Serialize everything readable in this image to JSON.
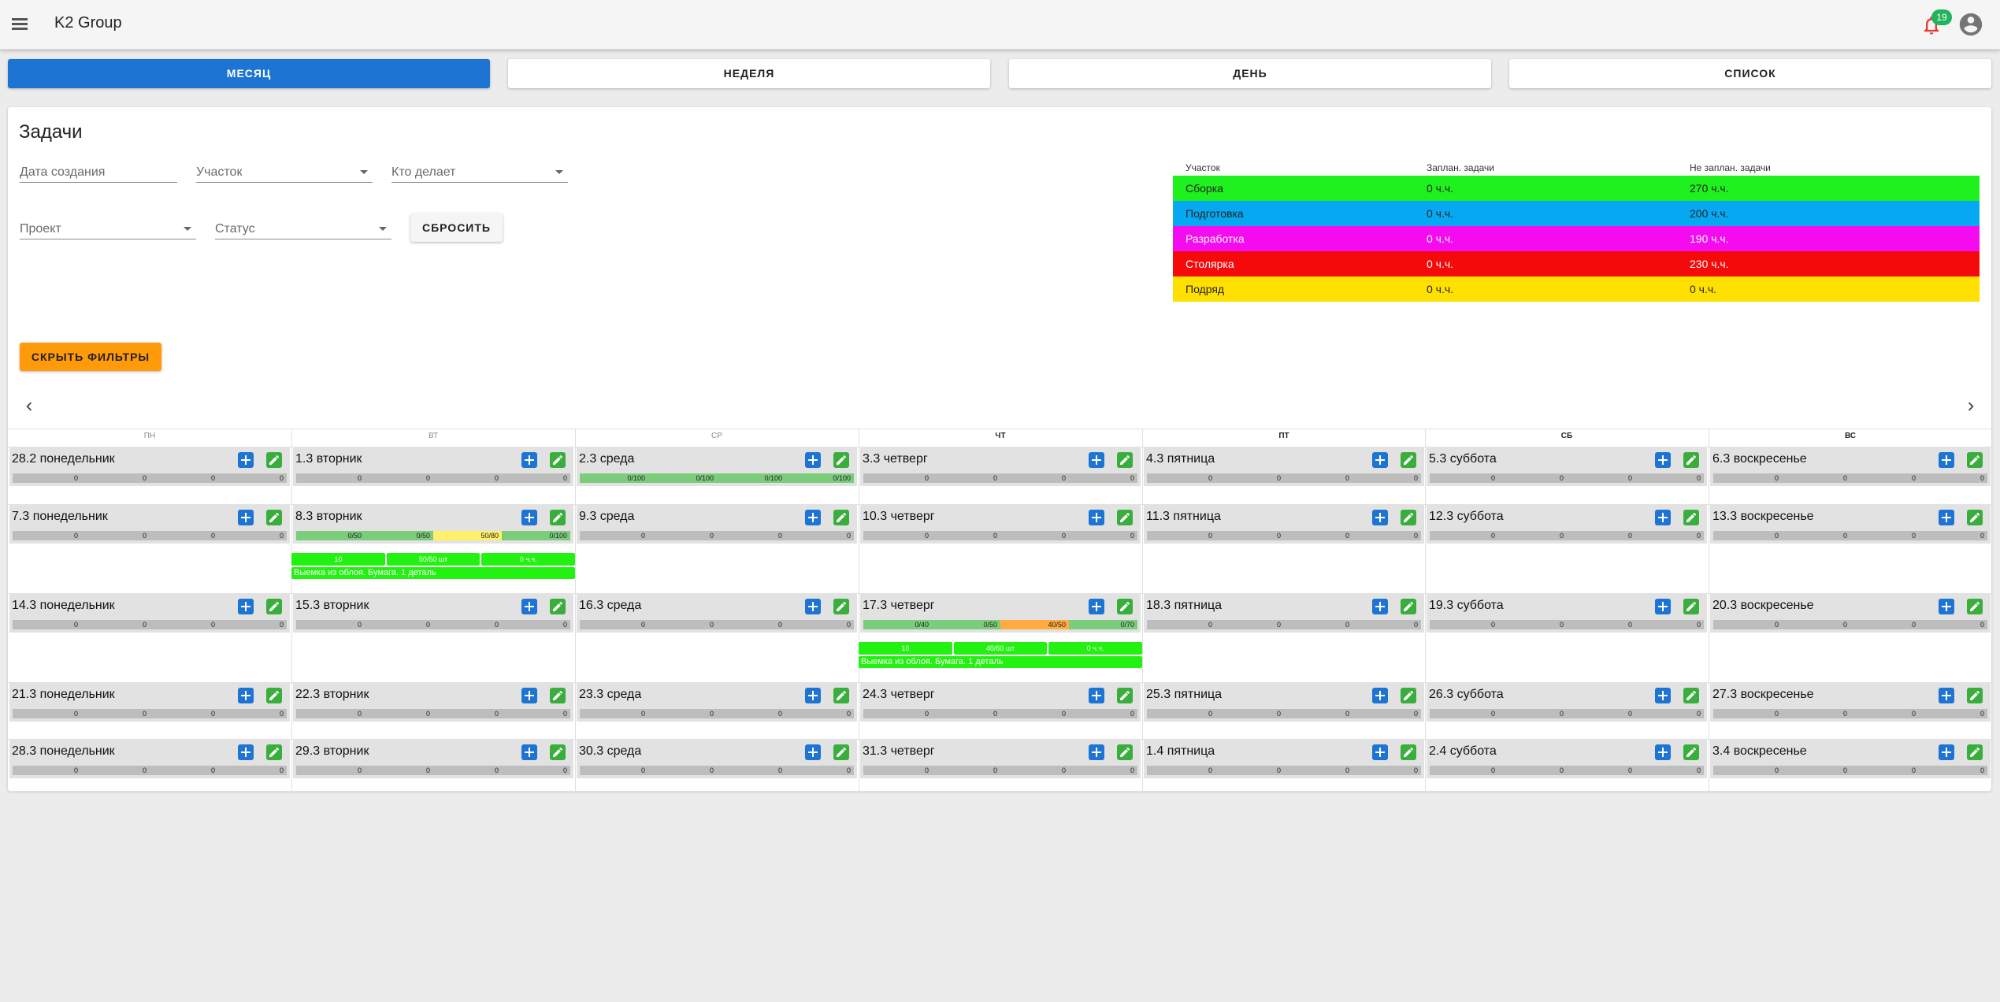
{
  "app": {
    "title": "K2 Group",
    "notifications": "19",
    "icons": {
      "menu": "menu-icon",
      "bell": "bell-icon",
      "account": "account-icon"
    }
  },
  "tabs": [
    "МЕСЯЦ",
    "НЕДЕЛЯ",
    "ДЕНЬ",
    "СПИСОК"
  ],
  "active_tab": "МЕСЯЦ",
  "page": {
    "title": "Задачи"
  },
  "filters": {
    "created": "Дата создания",
    "section": "Участок",
    "assignee": "Кто делает",
    "project": "Проект",
    "status": "Статус",
    "reset": "СБРОСИТЬ",
    "hide": "СКРЫТЬ ФИЛЬТРЫ"
  },
  "summary": {
    "headers": [
      "Участок",
      "Заплан. задачи",
      "Не заплан. задачи"
    ],
    "rows": [
      {
        "name": "Сборка",
        "planned": "0 ч.ч.",
        "unplanned": "270 ч.ч.",
        "color": "#1ef11e",
        "text": "#222222"
      },
      {
        "name": "Подготовка",
        "planned": "0 ч.ч.",
        "unplanned": "200 ч.ч.",
        "color": "#06a8f2",
        "text": "#222222"
      },
      {
        "name": "Разработка",
        "planned": "0 ч.ч.",
        "unplanned": "190 ч.ч.",
        "color": "#f50bf0",
        "text": "#ffffff"
      },
      {
        "name": "Столярка",
        "planned": "0 ч.ч.",
        "unplanned": "230 ч.ч.",
        "color": "#f40a0a",
        "text": "#ffffff"
      },
      {
        "name": "Подряд",
        "planned": "0 ч.ч.",
        "unplanned": "0 ч.ч.",
        "color": "#ffe000",
        "text": "#222222"
      }
    ]
  },
  "calendar": {
    "weekdays": [
      "ПН",
      "ВТ",
      "СР",
      "ЧТ",
      "ПТ",
      "СБ",
      "ВС"
    ],
    "bold_weekdays": [
      3,
      4,
      5,
      6
    ],
    "weeks": [
      {
        "days": [
          {
            "label": "28.2 понедельник",
            "cap": [
              "0",
              "0",
              "0",
              "0"
            ]
          },
          {
            "label": "1.3 вторник",
            "cap": [
              "0",
              "0",
              "0",
              "0"
            ]
          },
          {
            "label": "2.3 среда",
            "cap": [
              "0/100",
              "0/100",
              "0/100",
              "0/100"
            ],
            "capcolors": [
              "g",
              "g",
              "g",
              "g"
            ]
          },
          {
            "label": "3.3 четверг",
            "cap": [
              "0",
              "0",
              "0",
              "0"
            ]
          },
          {
            "label": "4.3 пятница",
            "cap": [
              "0",
              "0",
              "0",
              "0"
            ]
          },
          {
            "label": "5.3 суббота",
            "cap": [
              "0",
              "0",
              "0",
              "0"
            ]
          },
          {
            "label": "6.3 воскресенье",
            "cap": [
              "0",
              "0",
              "0",
              "0"
            ]
          }
        ]
      },
      {
        "days": [
          {
            "label": "7.3 понедельник",
            "cap": [
              "0",
              "0",
              "0",
              "0"
            ]
          },
          {
            "label": "8.3 вторник",
            "cap": [
              "0/50",
              "0/50",
              "50/80",
              "0/100"
            ],
            "capcolors": [
              "g",
              "g",
              "y",
              "g"
            ],
            "task": {
              "cells": [
                "10",
                "50/50 шт",
                "0 ч.ч."
              ],
              "desc": "Выемка из облоя. Бумага. 1 деталь"
            }
          },
          {
            "label": "9.3 среда",
            "cap": [
              "0",
              "0",
              "0",
              "0"
            ]
          },
          {
            "label": "10.3 четверг",
            "cap": [
              "0",
              "0",
              "0",
              "0"
            ]
          },
          {
            "label": "11.3 пятница",
            "cap": [
              "0",
              "0",
              "0",
              "0"
            ]
          },
          {
            "label": "12.3 суббота",
            "cap": [
              "0",
              "0",
              "0",
              "0"
            ]
          },
          {
            "label": "13.3 воскресенье",
            "cap": [
              "0",
              "0",
              "0",
              "0"
            ]
          }
        ]
      },
      {
        "days": [
          {
            "label": "14.3 понедельник",
            "cap": [
              "0",
              "0",
              "0",
              "0"
            ]
          },
          {
            "label": "15.3 вторник",
            "cap": [
              "0",
              "0",
              "0",
              "0"
            ]
          },
          {
            "label": "16.3 среда",
            "cap": [
              "0",
              "0",
              "0",
              "0"
            ]
          },
          {
            "label": "17.3 четверг",
            "cap": [
              "0/40",
              "0/50",
              "40/50",
              "0/70"
            ],
            "capcolors": [
              "g",
              "g",
              "o",
              "g"
            ],
            "task": {
              "cells": [
                "10",
                "40/60 шт",
                "0 ч.ч."
              ],
              "desc": "Выемка из облоя. Бумага. 1 деталь"
            }
          },
          {
            "label": "18.3 пятница",
            "cap": [
              "0",
              "0",
              "0",
              "0"
            ]
          },
          {
            "label": "19.3 суббота",
            "cap": [
              "0",
              "0",
              "0",
              "0"
            ]
          },
          {
            "label": "20.3 воскресенье",
            "cap": [
              "0",
              "0",
              "0",
              "0"
            ]
          }
        ]
      },
      {
        "days": [
          {
            "label": "21.3 понедельник",
            "cap": [
              "0",
              "0",
              "0",
              "0"
            ]
          },
          {
            "label": "22.3 вторник",
            "cap": [
              "0",
              "0",
              "0",
              "0"
            ]
          },
          {
            "label": "23.3 среда",
            "cap": [
              "0",
              "0",
              "0",
              "0"
            ]
          },
          {
            "label": "24.3 четверг",
            "cap": [
              "0",
              "0",
              "0",
              "0"
            ]
          },
          {
            "label": "25.3 пятница",
            "cap": [
              "0",
              "0",
              "0",
              "0"
            ]
          },
          {
            "label": "26.3 суббота",
            "cap": [
              "0",
              "0",
              "0",
              "0"
            ]
          },
          {
            "label": "27.3 воскресенье",
            "cap": [
              "0",
              "0",
              "0",
              "0"
            ]
          }
        ]
      },
      {
        "days": [
          {
            "label": "28.3 понедельник",
            "cap": [
              "0",
              "0",
              "0",
              "0"
            ]
          },
          {
            "label": "29.3 вторник",
            "cap": [
              "0",
              "0",
              "0",
              "0"
            ]
          },
          {
            "label": "30.3 среда",
            "cap": [
              "0",
              "0",
              "0",
              "0"
            ]
          },
          {
            "label": "31.3 четверг",
            "cap": [
              "0",
              "0",
              "0",
              "0"
            ]
          },
          {
            "label": "1.4 пятница",
            "cap": [
              "0",
              "0",
              "0",
              "0"
            ]
          },
          {
            "label": "2.4 суббота",
            "cap": [
              "0",
              "0",
              "0",
              "0"
            ]
          },
          {
            "label": "3.4 воскресенье",
            "cap": [
              "0",
              "0",
              "0",
              "0"
            ]
          }
        ]
      }
    ]
  }
}
